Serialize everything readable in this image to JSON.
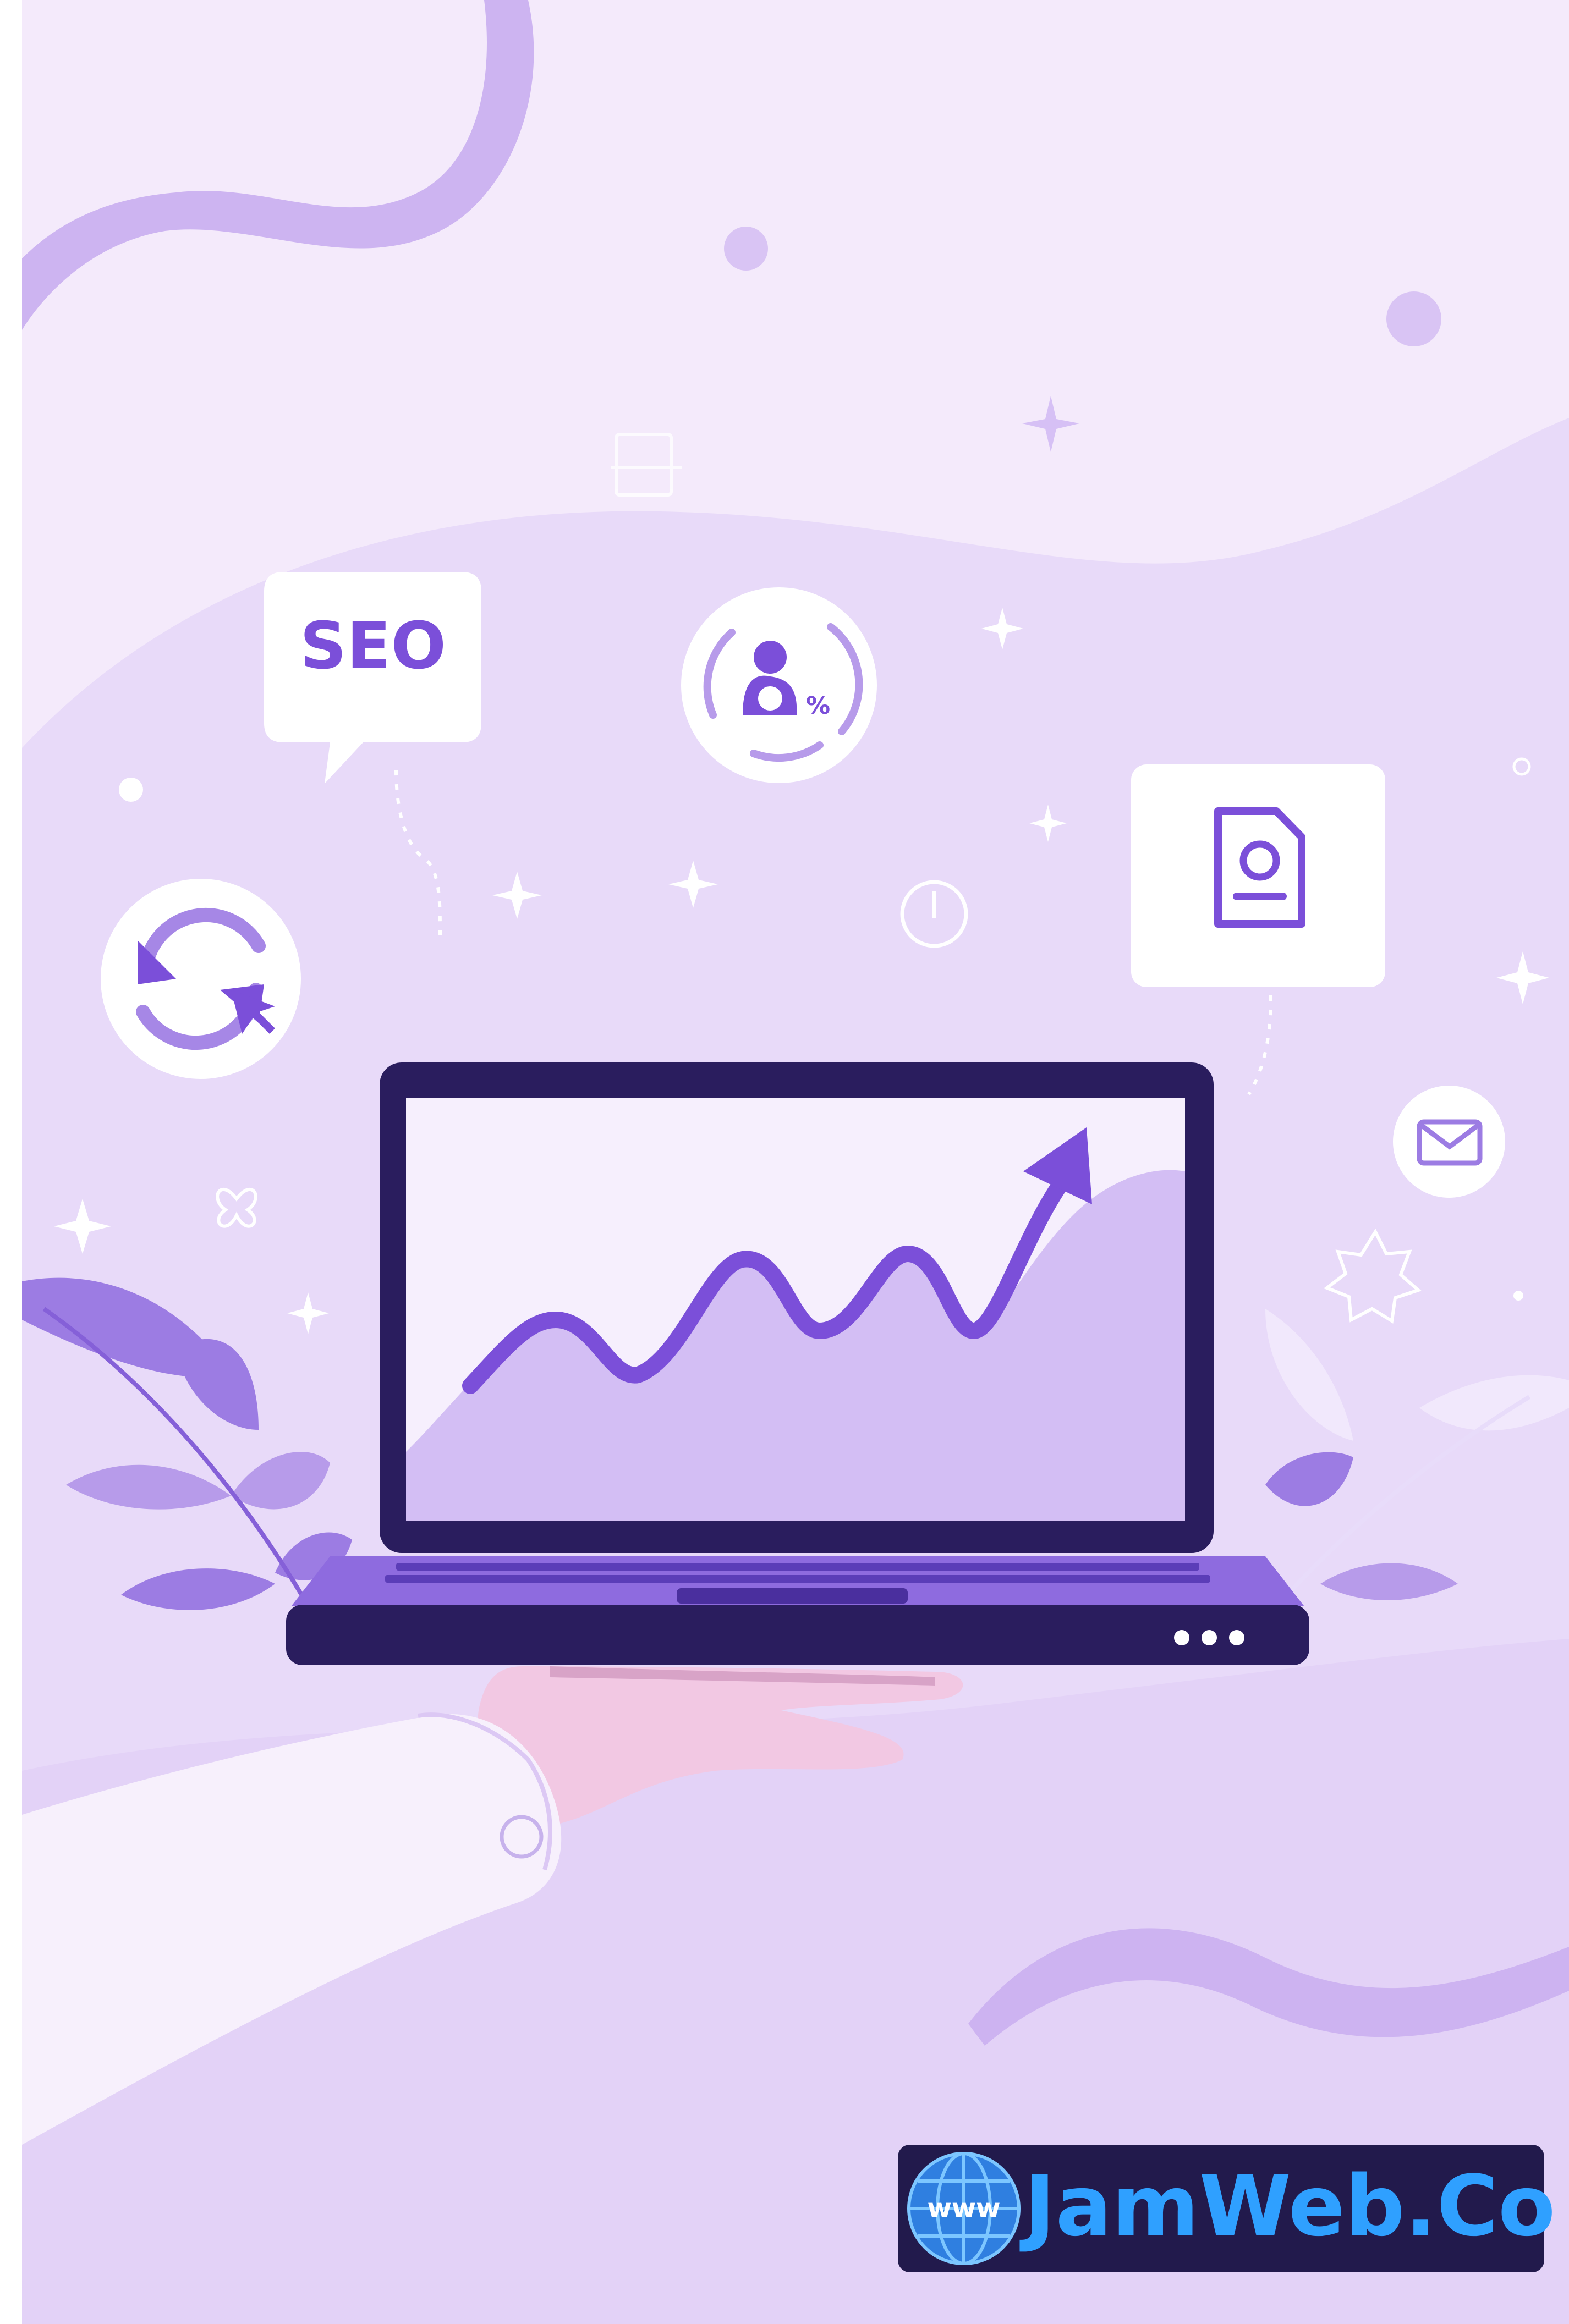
{
  "illustration": {
    "seo_bubble_text": "SEO",
    "percent_glyph": "%"
  },
  "branding": {
    "logo_text": "JamWeb.Co",
    "globe_text": "www"
  },
  "colors": {
    "background": "#F4EAFB",
    "background_wave": "#E9DCF9",
    "lower_area": "#E2D3F7",
    "accent_purple": "#7B4FD9",
    "dark_navy": "#2A1D5E",
    "light_purple": "#B79BEA",
    "white": "#FFFFFF",
    "logo_bg": "#221A4C",
    "logo_text": "#2FA0FF"
  },
  "icons": [
    "seo-speech-bubble-icon",
    "user-percent-badge-icon",
    "refresh-arrows-icon",
    "document-icon",
    "mail-icon",
    "clock-icon",
    "sparkle-icon",
    "leaf-icon",
    "globe-icon"
  ]
}
